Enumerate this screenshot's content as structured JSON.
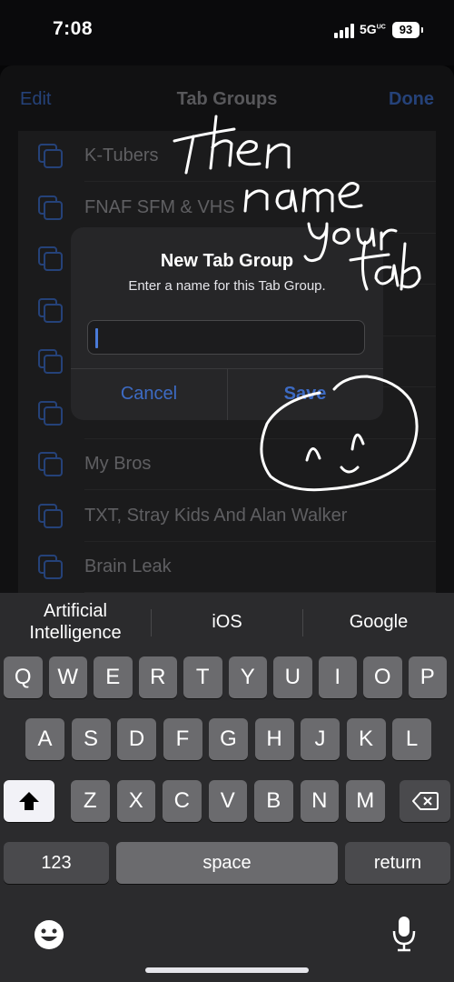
{
  "status_bar": {
    "time": "7:08",
    "network": "5G",
    "network_sup": "UC",
    "battery": "93"
  },
  "sheet": {
    "edit": "Edit",
    "title": "Tab Groups",
    "done": "Done",
    "groups": [
      {
        "label": "K-Tubers"
      },
      {
        "label": "FNAF SFM & VHS"
      },
      {
        "label": ""
      },
      {
        "label": ""
      },
      {
        "label": ""
      },
      {
        "label": ""
      },
      {
        "label": "My Bros"
      },
      {
        "label": "TXT, Stray Kids And Alan Walker"
      },
      {
        "label": "Brain Leak"
      }
    ]
  },
  "alert": {
    "title": "New Tab Group",
    "message": "Enter a name for this Tab Group.",
    "input_value": "",
    "cancel": "Cancel",
    "save": "Save"
  },
  "keyboard": {
    "suggestions": [
      "Artificial Intelligence",
      "iOS",
      "Google"
    ],
    "rows": [
      [
        "Q",
        "W",
        "E",
        "R",
        "T",
        "Y",
        "U",
        "I",
        "O",
        "P"
      ],
      [
        "A",
        "S",
        "D",
        "F",
        "G",
        "H",
        "J",
        "K",
        "L"
      ],
      [
        "Z",
        "X",
        "C",
        "V",
        "B",
        "N",
        "M"
      ]
    ],
    "numbers_key": "123",
    "space_key": "space",
    "return_key": "return"
  },
  "annotation": {
    "handwriting": [
      "Then",
      "name",
      "your",
      "tab"
    ]
  },
  "colors": {
    "accent": "#3d6bc4",
    "background": "#1c1c1e"
  }
}
